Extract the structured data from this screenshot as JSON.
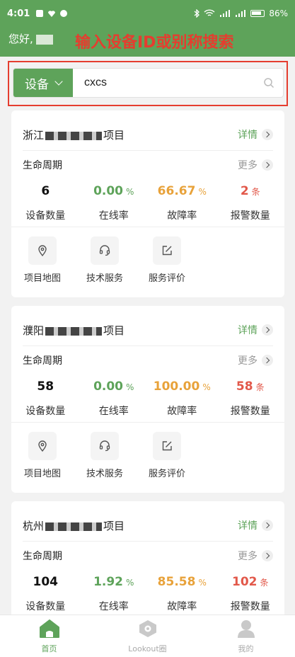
{
  "status_bar": {
    "time": "4:01",
    "battery": "86%"
  },
  "header": {
    "greeting": "您好,",
    "annotation": "输入设备ID或别称搜索"
  },
  "search": {
    "type_label": "设备",
    "value": "cxcs"
  },
  "cards": [
    {
      "name_prefix": "浙江",
      "name_suffix": "项目",
      "detail": "详情",
      "lifecycle": "生命周期",
      "more": "更多",
      "stats": [
        {
          "value": "6",
          "unit": "",
          "label": "设备数量",
          "color": "#111111"
        },
        {
          "value": "0.00",
          "unit": "%",
          "label": "在线率",
          "color": "#5ea35a"
        },
        {
          "value": "66.67",
          "unit": "%",
          "label": "故障率",
          "color": "#e8a23a"
        },
        {
          "value": "2",
          "unit": "条",
          "label": "报警数量",
          "color": "#e2584a"
        }
      ],
      "services": [
        {
          "label": "项目地图"
        },
        {
          "label": "技术服务"
        },
        {
          "label": "服务评价"
        }
      ]
    },
    {
      "name_prefix": "濮阳",
      "name_suffix": "项目",
      "detail": "详情",
      "lifecycle": "生命周期",
      "more": "更多",
      "stats": [
        {
          "value": "58",
          "unit": "",
          "label": "设备数量",
          "color": "#111111"
        },
        {
          "value": "0.00",
          "unit": "%",
          "label": "在线率",
          "color": "#5ea35a"
        },
        {
          "value": "100.00",
          "unit": "%",
          "label": "故障率",
          "color": "#e8a23a"
        },
        {
          "value": "58",
          "unit": "条",
          "label": "报警数量",
          "color": "#e2584a"
        }
      ],
      "services": [
        {
          "label": "项目地图"
        },
        {
          "label": "技术服务"
        },
        {
          "label": "服务评价"
        }
      ]
    },
    {
      "name_prefix": "杭州",
      "name_suffix": "项目",
      "detail": "详情",
      "lifecycle": "生命周期",
      "more": "更多",
      "stats": [
        {
          "value": "104",
          "unit": "",
          "label": "设备数量",
          "color": "#111111"
        },
        {
          "value": "1.92",
          "unit": "%",
          "label": "在线率",
          "color": "#5ea35a"
        },
        {
          "value": "85.58",
          "unit": "%",
          "label": "故障率",
          "color": "#e8a23a"
        },
        {
          "value": "102",
          "unit": "条",
          "label": "报警数量",
          "color": "#e2584a"
        }
      ],
      "services": []
    }
  ],
  "tabbar": [
    {
      "label": "首页",
      "icon": "home-icon",
      "active": true
    },
    {
      "label": "Lookout圈",
      "icon": "lookout-icon",
      "active": false
    },
    {
      "label": "我的",
      "icon": "profile-icon",
      "active": false
    }
  ],
  "colors": {
    "brand": "#5ea35a",
    "annotation": "#e53d2f"
  }
}
